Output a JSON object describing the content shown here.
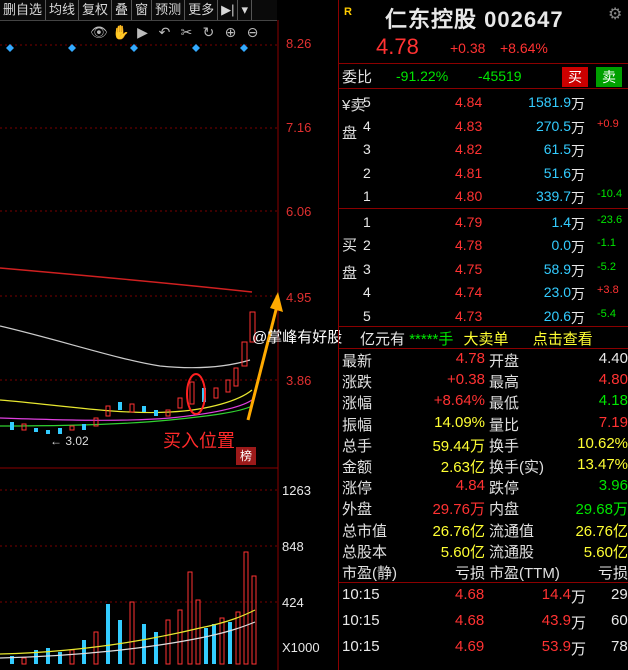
{
  "toolbar": {
    "items": [
      "删自选",
      "均线",
      "复权",
      "叠",
      "窗",
      "预测",
      "更多",
      "▶|",
      "▾"
    ]
  },
  "chart": {
    "price_ticks": [
      "8.26",
      "7.16",
      "6.06",
      "4.95",
      "3.86"
    ],
    "volume_ticks": [
      "1263",
      "848",
      "424",
      "X1000"
    ],
    "low_label": "← 3.02",
    "annotation": "买入位置",
    "badge": "榜",
    "watermark": "@掌峰有好股"
  },
  "stock": {
    "badge": "R",
    "name": "仁东控股",
    "code": "002647",
    "price": "4.78",
    "change": "+0.38",
    "change_pct": "+8.64%"
  },
  "weibi": {
    "label": "委比",
    "ratio": "-91.22%",
    "diff": "-45519",
    "buy_btn": "买",
    "sell_btn": "卖"
  },
  "asks_label": "¥卖盘",
  "asks": [
    {
      "lvl": "5",
      "price": "4.84",
      "vol": "1581.9",
      "unit": "万",
      "chg": ""
    },
    {
      "lvl": "4",
      "price": "4.83",
      "vol": "270.5",
      "unit": "万",
      "chg": "+0.9"
    },
    {
      "lvl": "3",
      "price": "4.82",
      "vol": "61.5",
      "unit": "万",
      "chg": ""
    },
    {
      "lvl": "2",
      "price": "4.81",
      "vol": "51.6",
      "unit": "万",
      "chg": ""
    },
    {
      "lvl": "1",
      "price": "4.80",
      "vol": "339.7",
      "unit": "万",
      "chg": "-10.4"
    }
  ],
  "bids_label": "买盘",
  "bids": [
    {
      "lvl": "1",
      "price": "4.79",
      "vol": "1.4",
      "unit": "万",
      "chg": "-23.6"
    },
    {
      "lvl": "2",
      "price": "4.78",
      "vol": "0.0",
      "unit": "万",
      "chg": "-1.1"
    },
    {
      "lvl": "3",
      "price": "4.75",
      "vol": "58.9",
      "unit": "万",
      "chg": "-5.2"
    },
    {
      "lvl": "4",
      "price": "4.74",
      "vol": "23.0",
      "unit": "万",
      "chg": "+3.8"
    },
    {
      "lvl": "5",
      "price": "4.73",
      "vol": "20.6",
      "unit": "万",
      "chg": "-5.4"
    }
  ],
  "ticker": {
    "text": "亿元有",
    "stars": "*****手",
    "big": "大卖单",
    "link": "点击查看"
  },
  "stats": [
    {
      "k1": "最新",
      "v1": "4.78",
      "c1": "red",
      "k2": "开盘",
      "v2": "4.40",
      "c2": "white"
    },
    {
      "k1": "涨跌",
      "v1": "+0.38",
      "c1": "red",
      "k2": "最高",
      "v2": "4.80",
      "c2": "red"
    },
    {
      "k1": "涨幅",
      "v1": "+8.64%",
      "c1": "red",
      "k2": "最低",
      "v2": "4.18",
      "c2": "green"
    },
    {
      "k1": "振幅",
      "v1": "14.09%",
      "c1": "yellow",
      "k2": "量比",
      "v2": "7.19",
      "c2": "red"
    },
    {
      "k1": "总手",
      "v1": "59.44万",
      "c1": "yellow",
      "k2": "换手",
      "v2": "10.62%",
      "c2": "yellow"
    },
    {
      "k1": "金额",
      "v1": "2.63亿",
      "c1": "yellow",
      "k2": "换手(实)",
      "v2": "13.47%",
      "c2": "yellow"
    },
    {
      "k1": "涨停",
      "v1": "4.84",
      "c1": "red",
      "k2": "跌停",
      "v2": "3.96",
      "c2": "green"
    },
    {
      "k1": "外盘",
      "v1": "29.76万",
      "c1": "red",
      "k2": "内盘",
      "v2": "29.68万",
      "c2": "green"
    },
    {
      "k1": "总市值",
      "v1": "26.76亿",
      "c1": "yellow",
      "k2": "流通值",
      "v2": "26.76亿",
      "c2": "yellow"
    },
    {
      "k1": "总股本",
      "v1": "5.60亿",
      "c1": "yellow",
      "k2": "流通股",
      "v2": "5.60亿",
      "c2": "yellow"
    },
    {
      "k1": "市盈(静)",
      "v1": "亏损",
      "c1": "white",
      "k2": "市盈(TTM)",
      "v2": "亏损",
      "c2": "white"
    }
  ],
  "ticks": [
    {
      "time": "10:15",
      "price": "4.68",
      "vol": "14.4",
      "unit": "万",
      "extra": "29"
    },
    {
      "time": "10:15",
      "price": "4.68",
      "vol": "43.9",
      "unit": "万",
      "extra": "60"
    },
    {
      "time": "10:15",
      "price": "4.69",
      "vol": "53.9",
      "unit": "万",
      "extra": "78"
    }
  ],
  "colors": {
    "up": "#ff3232",
    "down": "#00e600",
    "divider": "#8b0000"
  }
}
